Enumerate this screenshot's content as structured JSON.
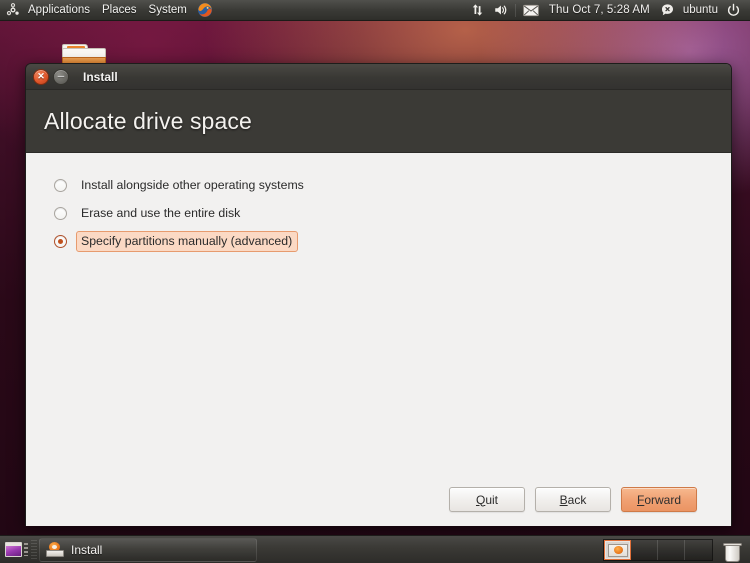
{
  "desktop": {
    "top_panel": {
      "logo_icon": "ubuntu-logo-icon",
      "menus": [
        {
          "label": "Applications",
          "name": "menu-applications"
        },
        {
          "label": "Places",
          "name": "menu-places"
        },
        {
          "label": "System",
          "name": "menu-system"
        }
      ],
      "firefox_icon": "firefox-icon",
      "indicators": {
        "network_icon": "network-transfer-icon",
        "volume_icon": "volume-speaker-icon",
        "mail_icon": "envelope-mail-icon",
        "clock": "Thu Oct  7,  5:28 AM",
        "user_status_icon": "chat-status-icon",
        "username": "ubuntu",
        "power_icon": "power-button-icon"
      }
    },
    "desktop_icon": "install-media-folder-icon"
  },
  "window": {
    "titlebar": {
      "title": "Install",
      "close_icon": "close-x-icon",
      "close_glyph": "✕",
      "minimize_icon": "minimize-dash-icon",
      "minimize_glyph": "─"
    },
    "header": {
      "title": "Allocate drive space"
    },
    "options": [
      {
        "label": "Install alongside other operating systems",
        "name": "radio-install-alongside",
        "selected": false
      },
      {
        "label": "Erase and use the entire disk",
        "name": "radio-erase-entire-disk",
        "selected": false
      },
      {
        "label": "Specify partitions manually (advanced)",
        "name": "radio-specify-partitions-manually",
        "selected": true
      }
    ],
    "footer_buttons": [
      {
        "mnemonic": "Q",
        "rest": "uit",
        "name": "quit-button",
        "primary": false
      },
      {
        "mnemonic": "B",
        "rest": "ack",
        "name": "back-button",
        "primary": false
      },
      {
        "mnemonic": "F",
        "rest": "orward",
        "name": "forward-button",
        "primary": true
      }
    ]
  },
  "taskbar": {
    "show_desktop_icon": "show-desktop-icon",
    "task": {
      "label": "Install",
      "icon": "installer-disk-icon"
    },
    "workspaces": [
      {
        "name": "workspace-1",
        "active": true
      },
      {
        "name": "workspace-2",
        "active": false
      },
      {
        "name": "workspace-3",
        "active": false
      },
      {
        "name": "workspace-4",
        "active": false
      }
    ],
    "trash_icon": "trash-can-icon"
  },
  "colors": {
    "accent_orange": "#e8762a",
    "window_header": "#3b3a36",
    "body_background": "#f2f1f0",
    "selected_highlight": "#fbd9c4",
    "primary_button": "#f0a173"
  }
}
